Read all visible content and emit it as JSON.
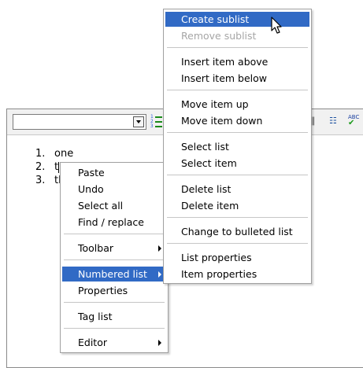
{
  "editor": {
    "toolbar": {
      "format_select_value": "",
      "icons": [
        "numbered-list-icon",
        "attachment-icon",
        "tree-icon",
        "spellcheck-icon"
      ],
      "spell_label": "ABC"
    },
    "list_numbers": [
      "1.",
      "2.",
      "3."
    ],
    "list_items": [
      "one",
      "t",
      "th"
    ]
  },
  "context_menu": {
    "paste": "Paste",
    "undo": "Undo",
    "select_all": "Select all",
    "find_replace": "Find / replace",
    "toolbar": "Toolbar",
    "numbered_list": "Numbered list",
    "properties": "Properties",
    "tag_list": "Tag list",
    "editor": "Editor"
  },
  "submenu": {
    "create_sublist": "Create sublist",
    "remove_sublist": "Remove sublist",
    "insert_above": "Insert item above",
    "insert_below": "Insert item below",
    "move_up": "Move item up",
    "move_down": "Move item down",
    "select_list": "Select list",
    "select_item": "Select item",
    "delete_list": "Delete list",
    "delete_item": "Delete item",
    "change_bulleted": "Change to bulleted list",
    "list_properties": "List properties",
    "item_properties": "Item properties"
  },
  "colors": {
    "highlight": "#316ac5",
    "disabled_text": "#a6a6a6",
    "toolbar_bg": "#f1f1f1"
  }
}
